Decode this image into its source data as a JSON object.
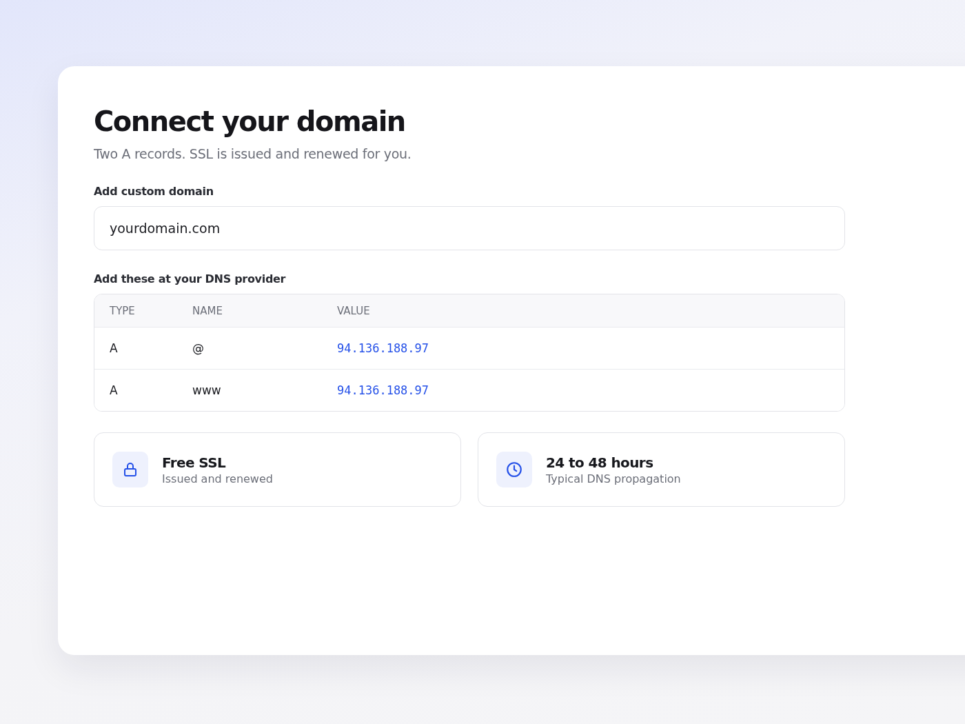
{
  "title": "Connect your domain",
  "subtitle": "Two A records. SSL is issued and renewed for you.",
  "domain_field": {
    "label": "Add custom domain",
    "value": "yourdomain.com"
  },
  "dns_table": {
    "label": "Add these at your DNS provider",
    "columns": [
      "TYPE",
      "NAME",
      "VALUE"
    ],
    "rows": [
      {
        "type": "A",
        "name": "@",
        "value": "94.136.188.97"
      },
      {
        "type": "A",
        "name": "www",
        "value": "94.136.188.97"
      }
    ]
  },
  "info_cards": [
    {
      "kind": "lock",
      "title": "Free SSL",
      "subtitle": "Issued and renewed"
    },
    {
      "kind": "clock",
      "title": "24 to 48 hours",
      "subtitle": "Typical DNS propagation"
    }
  ]
}
